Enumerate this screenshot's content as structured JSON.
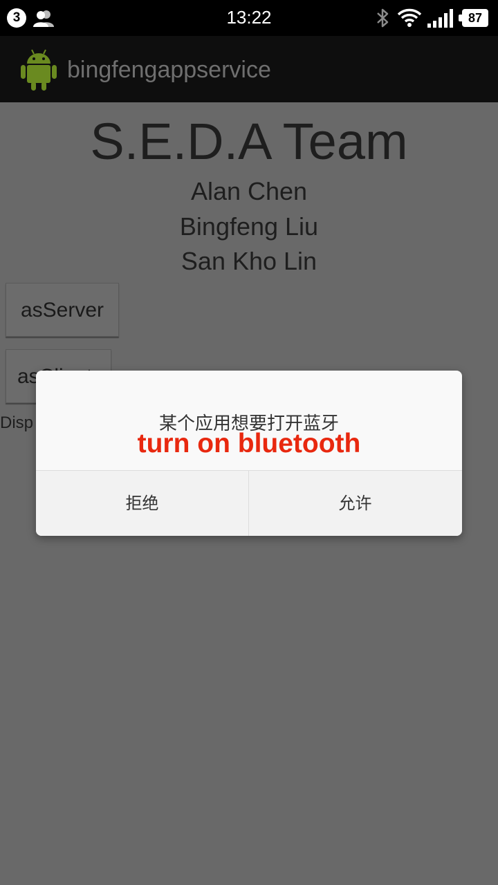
{
  "status_bar": {
    "notification_count": "3",
    "time": "13:22",
    "battery_level": "87",
    "icons": [
      "notification-count-icon",
      "people-icon",
      "bluetooth-icon",
      "wifi-icon",
      "signal-icon",
      "battery-icon"
    ]
  },
  "action_bar": {
    "app_title": "bingfengappservice",
    "app_icon": "android-icon"
  },
  "content": {
    "team_title": "S.E.D.A Team",
    "members": [
      "Alan Chen",
      "Bingfeng Liu",
      "San Kho Lin"
    ],
    "as_server_label": "asServer",
    "as_client_label": "asClient",
    "display_label": "Disp"
  },
  "dialog": {
    "message": "某个应用想要打开蓝牙",
    "highlight": "turn on bluetooth",
    "deny_label": "拒绝",
    "allow_label": "允许"
  },
  "colors": {
    "scrim_background": "#696969",
    "status_bar": "#000000",
    "action_bar": "#0e0e0e",
    "highlight_red": "#e8280f",
    "dialog_background": "#f9f9f9"
  }
}
